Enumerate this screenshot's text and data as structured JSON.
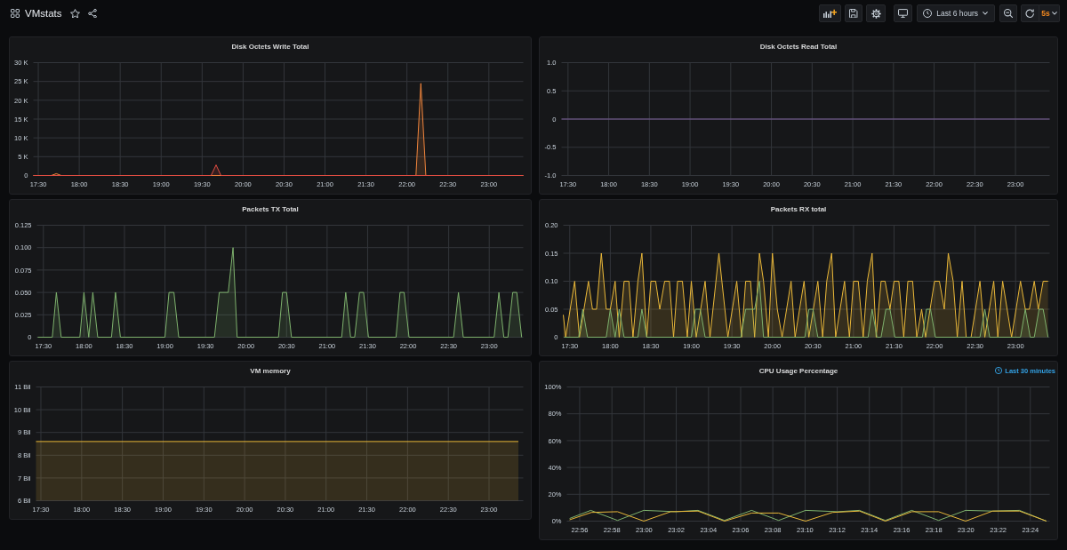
{
  "header": {
    "title": "VMstats",
    "time_range": "Last 6 hours",
    "refresh_interval": "5s"
  },
  "panels": [
    {
      "chart_data": {
        "title": "Disk Octets Write Total",
        "type": "area",
        "grid": true,
        "xlim": [
          17.44,
          23.42
        ],
        "ylim": [
          0,
          30000
        ],
        "xticks": [
          {
            "value": 17.5,
            "label": "17:30"
          },
          {
            "value": 18,
            "label": "18:00"
          },
          {
            "value": 18.5,
            "label": "18:30"
          },
          {
            "value": 19,
            "label": "19:00"
          },
          {
            "value": 19.5,
            "label": "19:30"
          },
          {
            "value": 20,
            "label": "20:00"
          },
          {
            "value": 20.5,
            "label": "20:30"
          },
          {
            "value": 21,
            "label": "21:00"
          },
          {
            "value": 21.5,
            "label": "21:30"
          },
          {
            "value": 22,
            "label": "22:00"
          },
          {
            "value": 22.5,
            "label": "22:30"
          },
          {
            "value": 23,
            "label": "23:00"
          }
        ],
        "yticks": [
          {
            "value": 0,
            "label": "0"
          },
          {
            "value": 5000,
            "label": "5 K"
          },
          {
            "value": 10000,
            "label": "10 K"
          },
          {
            "value": 15000,
            "label": "15 K"
          },
          {
            "value": 20000,
            "label": "20 K"
          },
          {
            "value": 25000,
            "label": "25 K"
          },
          {
            "value": 30000,
            "label": "30 K"
          }
        ],
        "series": [
          {
            "color": "#ef843c",
            "x": [
              17.44,
              17.66,
              17.72,
              17.78,
              22.11,
              22.17,
              22.23,
              23.42
            ],
            "values": [
              0,
              0,
              500,
              0,
              0,
              24500,
              0,
              0
            ]
          },
          {
            "color": "#e24d42",
            "x": [
              17.44,
              19.61,
              19.67,
              19.73,
              23.42
            ],
            "values": [
              0,
              0,
              2800,
              0,
              0
            ]
          }
        ]
      }
    },
    {
      "chart_data": {
        "title": "Disk Octets Read Total",
        "type": "line",
        "grid": true,
        "xlim": [
          17.42,
          23.42
        ],
        "ylim": [
          -1,
          1
        ],
        "xticks": [
          {
            "value": 17.5,
            "label": "17:30"
          },
          {
            "value": 18,
            "label": "18:00"
          },
          {
            "value": 18.5,
            "label": "18:30"
          },
          {
            "value": 19,
            "label": "19:00"
          },
          {
            "value": 19.5,
            "label": "19:30"
          },
          {
            "value": 20,
            "label": "20:00"
          },
          {
            "value": 20.5,
            "label": "20:30"
          },
          {
            "value": 21,
            "label": "21:00"
          },
          {
            "value": 21.5,
            "label": "21:30"
          },
          {
            "value": 22,
            "label": "22:00"
          },
          {
            "value": 22.5,
            "label": "22:30"
          },
          {
            "value": 23,
            "label": "23:00"
          }
        ],
        "yticks": [
          {
            "value": -1,
            "label": "-1.0"
          },
          {
            "value": -0.5,
            "label": "-0.5"
          },
          {
            "value": 0,
            "label": "0"
          },
          {
            "value": 0.5,
            "label": "0.5"
          },
          {
            "value": 1,
            "label": "1.0"
          }
        ],
        "series": [
          {
            "color": "#7a5f9a",
            "x": [
              17.42,
              23.42
            ],
            "values": [
              0,
              0
            ]
          }
        ]
      }
    },
    {
      "chart_data": {
        "title": "Packets TX Total",
        "type": "area",
        "grid": true,
        "xlim": [
          17.42,
          23.42
        ],
        "ylim": [
          0,
          0.125
        ],
        "xticks": [
          {
            "value": 17.5,
            "label": "17:30"
          },
          {
            "value": 18,
            "label": "18:00"
          },
          {
            "value": 18.5,
            "label": "18:30"
          },
          {
            "value": 19,
            "label": "19:00"
          },
          {
            "value": 19.5,
            "label": "19:30"
          },
          {
            "value": 20,
            "label": "20:00"
          },
          {
            "value": 20.5,
            "label": "20:30"
          },
          {
            "value": 21,
            "label": "21:00"
          },
          {
            "value": 21.5,
            "label": "21:30"
          },
          {
            "value": 22,
            "label": "22:00"
          },
          {
            "value": 22.5,
            "label": "22:30"
          },
          {
            "value": 23,
            "label": "23:00"
          }
        ],
        "yticks": [
          {
            "value": 0,
            "label": "0"
          },
          {
            "value": 0.025,
            "label": "0.025"
          },
          {
            "value": 0.05,
            "label": "0.050"
          },
          {
            "value": 0.075,
            "label": "0.075"
          },
          {
            "value": 0.1,
            "label": "0.100"
          },
          {
            "value": 0.125,
            "label": "0.125"
          }
        ],
        "series": [
          {
            "color": "#7eb26d",
            "x": [
              17.43,
              17.61,
              17.66,
              17.72,
              17.95,
              18.0,
              18.06,
              18.11,
              18.17,
              18.34,
              18.39,
              18.45,
              19.0,
              19.05,
              19.11,
              19.17,
              19.61,
              19.67,
              19.78,
              19.84,
              19.89,
              20.4,
              20.45,
              20.5,
              20.56,
              21.18,
              21.23,
              21.29,
              21.34,
              21.4,
              21.45,
              21.51,
              21.85,
              21.9,
              21.95,
              22.01,
              22.56,
              22.62,
              22.68,
              23.06,
              23.12,
              23.18,
              23.23,
              23.29,
              23.34,
              23.4
            ],
            "values": [
              0,
              0,
              0.05,
              0,
              0,
              0.05,
              0,
              0.05,
              0,
              0,
              0.05,
              0,
              0,
              0.05,
              0.05,
              0,
              0,
              0.05,
              0.05,
              0.1,
              0,
              0,
              0.05,
              0.05,
              0,
              0,
              0.05,
              0,
              0,
              0.05,
              0.05,
              0,
              0,
              0.05,
              0.05,
              0,
              0,
              0.05,
              0,
              0,
              0.05,
              0,
              0,
              0.05,
              0.05,
              0
            ]
          }
        ]
      }
    },
    {
      "chart_data": {
        "title": "Packets RX total",
        "type": "area",
        "grid": true,
        "xlim": [
          17.42,
          23.42
        ],
        "ylim": [
          0,
          0.2
        ],
        "xticks": [
          {
            "value": 17.5,
            "label": "17:30"
          },
          {
            "value": 18,
            "label": "18:00"
          },
          {
            "value": 18.5,
            "label": "18:30"
          },
          {
            "value": 19,
            "label": "19:00"
          },
          {
            "value": 19.5,
            "label": "19:30"
          },
          {
            "value": 20,
            "label": "20:00"
          },
          {
            "value": 20.5,
            "label": "20:30"
          },
          {
            "value": 21,
            "label": "21:00"
          },
          {
            "value": 21.5,
            "label": "21:30"
          },
          {
            "value": 22,
            "label": "22:00"
          },
          {
            "value": 22.5,
            "label": "22:30"
          },
          {
            "value": 23,
            "label": "23:00"
          }
        ],
        "yticks": [
          {
            "value": 0,
            "label": "0"
          },
          {
            "value": 0.05,
            "label": "0.05"
          },
          {
            "value": 0.1,
            "label": "0.10"
          },
          {
            "value": 0.15,
            "label": "0.15"
          },
          {
            "value": 0.2,
            "label": "0.20"
          }
        ],
        "series": [
          {
            "color": "#eab839",
            "x": [
              17.42,
              17.45,
              17.56,
              17.62,
              17.73,
              17.78,
              17.83,
              17.89,
              17.95,
              18.0,
              18.06,
              18.11,
              18.17,
              18.23,
              18.28,
              18.34,
              18.39,
              18.45,
              18.5,
              18.56,
              18.61,
              18.67,
              18.73,
              18.78,
              18.83,
              18.89,
              18.95,
              19.0,
              19.06,
              19.17,
              19.23,
              19.34,
              19.45,
              19.56,
              19.62,
              19.67,
              19.73,
              19.78,
              19.84,
              19.89,
              19.95,
              20.0,
              20.06,
              20.12,
              20.23,
              20.28,
              20.39,
              20.45,
              20.56,
              20.62,
              20.67,
              20.73,
              20.78,
              20.89,
              20.95,
              21.0,
              21.06,
              21.12,
              21.17,
              21.23,
              21.28,
              21.34,
              21.39,
              21.45,
              21.5,
              21.56,
              21.62,
              21.67,
              21.73,
              21.78,
              21.84,
              21.89,
              22.0,
              22.06,
              22.12,
              22.17,
              22.23,
              22.28,
              22.34,
              22.39,
              22.45,
              22.56,
              22.62,
              22.73,
              22.78,
              22.84,
              22.95,
              23.06,
              23.12,
              23.17,
              23.23,
              23.28,
              23.34,
              23.4
            ],
            "values": [
              0.04,
              0,
              0.1,
              0,
              0.1,
              0.05,
              0.05,
              0.15,
              0.05,
              0.05,
              0.1,
              0,
              0.1,
              0.1,
              0,
              0.1,
              0.15,
              0,
              0.1,
              0.1,
              0.05,
              0.1,
              0.1,
              0,
              0.1,
              0.1,
              0,
              0.1,
              0,
              0.1,
              0,
              0.15,
              0,
              0.1,
              0,
              0.1,
              0.1,
              0,
              0.15,
              0.1,
              0,
              0.15,
              0.05,
              0,
              0.1,
              0,
              0.1,
              0,
              0.1,
              0,
              0.1,
              0.15,
              0,
              0.1,
              0,
              0.1,
              0.1,
              0,
              0.1,
              0.15,
              0,
              0.1,
              0.1,
              0.05,
              0.1,
              0.1,
              0,
              0.1,
              0.1,
              0,
              0.05,
              0,
              0.1,
              0.1,
              0.05,
              0.15,
              0.1,
              0,
              0.1,
              0,
              0,
              0.1,
              0,
              0.1,
              0,
              0.1,
              0,
              0.1,
              0.05,
              0.05,
              0.1,
              0.05,
              0.1,
              0.1
            ]
          },
          {
            "color": "#7eb26d",
            "x": [
              17.43,
              17.61,
              17.66,
              17.72,
              17.95,
              18.0,
              18.06,
              18.11,
              18.17,
              18.34,
              18.39,
              18.45,
              19.0,
              19.05,
              19.11,
              19.17,
              19.61,
              19.67,
              19.78,
              19.84,
              19.89,
              20.4,
              20.45,
              20.5,
              20.56,
              21.18,
              21.23,
              21.29,
              21.34,
              21.4,
              21.45,
              21.51,
              21.85,
              21.9,
              21.95,
              22.01,
              22.56,
              22.62,
              22.68,
              23.06,
              23.12,
              23.18,
              23.23,
              23.29,
              23.34,
              23.4
            ],
            "values": [
              0,
              0,
              0.05,
              0,
              0,
              0.05,
              0,
              0.05,
              0,
              0,
              0.05,
              0,
              0,
              0.05,
              0.05,
              0,
              0,
              0.05,
              0.05,
              0.1,
              0,
              0,
              0.05,
              0.05,
              0,
              0,
              0.05,
              0,
              0,
              0.05,
              0.05,
              0,
              0,
              0.05,
              0.05,
              0,
              0,
              0.05,
              0,
              0,
              0.05,
              0,
              0,
              0.05,
              0.05,
              0
            ]
          }
        ]
      }
    },
    {
      "chart_data": {
        "title": "VM memory",
        "type": "area",
        "grid": true,
        "xlim": [
          17.44,
          23.42
        ],
        "ylim": [
          6,
          11
        ],
        "xticks": [
          {
            "value": 17.5,
            "label": "17:30"
          },
          {
            "value": 18,
            "label": "18:00"
          },
          {
            "value": 18.5,
            "label": "18:30"
          },
          {
            "value": 19,
            "label": "19:00"
          },
          {
            "value": 19.5,
            "label": "19:30"
          },
          {
            "value": 20,
            "label": "20:00"
          },
          {
            "value": 20.5,
            "label": "20:30"
          },
          {
            "value": 21,
            "label": "21:00"
          },
          {
            "value": 21.5,
            "label": "21:30"
          },
          {
            "value": 22,
            "label": "22:00"
          },
          {
            "value": 22.5,
            "label": "22:30"
          },
          {
            "value": 23,
            "label": "23:00"
          }
        ],
        "yticks": [
          {
            "value": 6,
            "label": "6 Bil"
          },
          {
            "value": 7,
            "label": "7 Bil"
          },
          {
            "value": 8,
            "label": "8 Bil"
          },
          {
            "value": 9,
            "label": "9 Bil"
          },
          {
            "value": 10,
            "label": "10 Bil"
          },
          {
            "value": 11,
            "label": "11 Bil"
          }
        ],
        "series": [
          {
            "color": "#eab839",
            "x": [
              17.44,
              23.36
            ],
            "values": [
              8.6,
              8.6
            ]
          }
        ]
      }
    },
    {
      "time_override": "Last 30 minutes",
      "chart_data": {
        "title": "CPU Usage Percentage",
        "type": "line",
        "grid": true,
        "xlim": [
          22.92,
          23.42
        ],
        "ylim": [
          0,
          100
        ],
        "xticks": [
          {
            "value": 22.9333,
            "label": "22:56"
          },
          {
            "value": 22.9667,
            "label": "22:58"
          },
          {
            "value": 23,
            "label": "23:00"
          },
          {
            "value": 23.0333,
            "label": "23:02"
          },
          {
            "value": 23.0667,
            "label": "23:04"
          },
          {
            "value": 23.1,
            "label": "23:06"
          },
          {
            "value": 23.1333,
            "label": "23:08"
          },
          {
            "value": 23.1667,
            "label": "23:10"
          },
          {
            "value": 23.2,
            "label": "23:12"
          },
          {
            "value": 23.2333,
            "label": "23:14"
          },
          {
            "value": 23.2667,
            "label": "23:16"
          },
          {
            "value": 23.3,
            "label": "23:18"
          },
          {
            "value": 23.3333,
            "label": "23:20"
          },
          {
            "value": 23.3667,
            "label": "23:22"
          },
          {
            "value": 23.4,
            "label": "23:24"
          }
        ],
        "yticks": [
          {
            "value": 0,
            "label": "0%"
          },
          {
            "value": 20,
            "label": "20%"
          },
          {
            "value": 40,
            "label": "40%"
          },
          {
            "value": 60,
            "label": "60%"
          },
          {
            "value": 80,
            "label": "80%"
          },
          {
            "value": 100,
            "label": "100%"
          }
        ],
        "series": [
          {
            "color": "#7eb26d",
            "x": [
              22.9229,
              22.9448,
              22.9725,
              22.9997,
              23.0328,
              23.0558,
              23.0833,
              23.1113,
              23.1393,
              23.1672,
              23.2003,
              23.223,
              23.2498,
              23.2772,
              23.305,
              23.333,
              23.3608,
              23.3888,
              23.4167
            ],
            "values": [
              2,
              8,
              0.5,
              8,
              7,
              8,
              0.5,
              8,
              0.5,
              8,
              7,
              8,
              0.5,
              8,
              0.5,
              8,
              7.5,
              8,
              0
            ]
          },
          {
            "color": "#eab839",
            "x": [
              22.9229,
              22.9455,
              22.9725,
              22.9997,
              23.0275,
              23.0558,
              23.0833,
              23.1113,
              23.1393,
              23.1672,
              23.1952,
              23.223,
              23.2498,
              23.2772,
              23.305,
              23.333,
              23.3608,
              23.3888,
              23.4167
            ],
            "values": [
              1,
              6.5,
              7,
              0,
              7,
              7.5,
              0,
              6,
              6,
              0,
              6.5,
              7.5,
              0,
              7,
              7,
              0,
              7.5,
              7.5,
              0
            ]
          }
        ]
      }
    }
  ]
}
